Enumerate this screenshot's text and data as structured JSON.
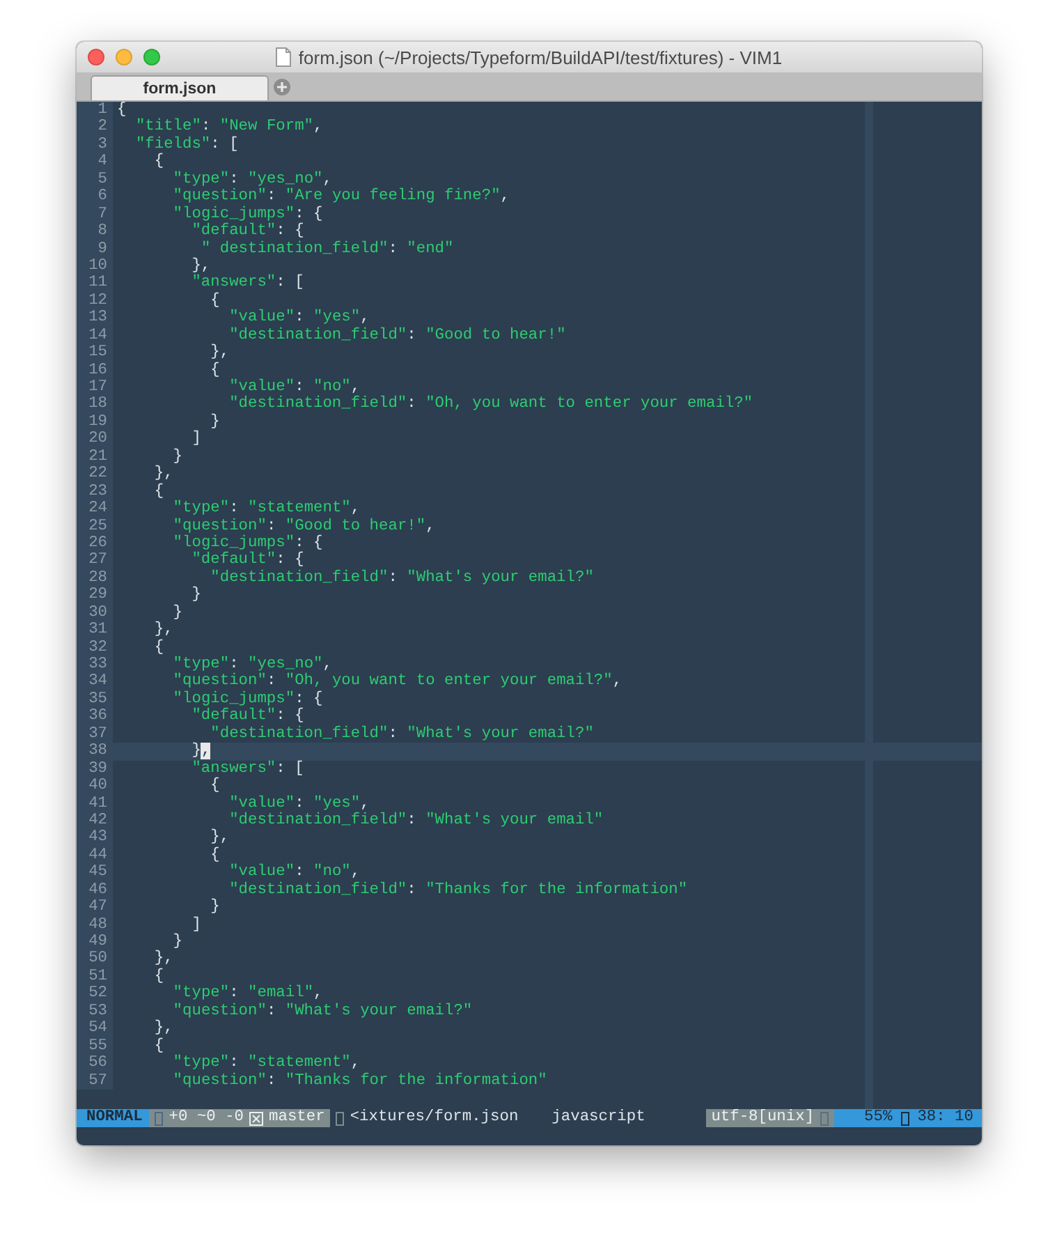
{
  "window": {
    "title": "form.json (~/Projects/Typeform/BuildAPI/test/fixtures) - VIM1"
  },
  "tabs": [
    {
      "label": "form.json",
      "selected": true
    }
  ],
  "lines": [
    {
      "n": "1",
      "text": "{",
      "current": false
    },
    {
      "n": "2",
      "text": "  \"title\": \"New Form\",",
      "current": false
    },
    {
      "n": "3",
      "text": "  \"fields\": [",
      "current": false
    },
    {
      "n": "4",
      "text": "    {",
      "current": false
    },
    {
      "n": "5",
      "text": "      \"type\": \"yes_no\",",
      "current": false
    },
    {
      "n": "6",
      "text": "      \"question\": \"Are you feeling fine?\",",
      "current": false
    },
    {
      "n": "7",
      "text": "      \"logic_jumps\": {",
      "current": false
    },
    {
      "n": "8",
      "text": "        \"default\": {",
      "current": false
    },
    {
      "n": "9",
      "text": "         \" destination_field\": \"end\"",
      "current": false
    },
    {
      "n": "10",
      "text": "        },",
      "current": false
    },
    {
      "n": "11",
      "text": "        \"answers\": [",
      "current": false
    },
    {
      "n": "12",
      "text": "          {",
      "current": false
    },
    {
      "n": "13",
      "text": "            \"value\": \"yes\",",
      "current": false
    },
    {
      "n": "14",
      "text": "            \"destination_field\": \"Good to hear!\"",
      "current": false
    },
    {
      "n": "15",
      "text": "          },",
      "current": false
    },
    {
      "n": "16",
      "text": "          {",
      "current": false
    },
    {
      "n": "17",
      "text": "            \"value\": \"no\",",
      "current": false
    },
    {
      "n": "18",
      "text": "            \"destination_field\": \"Oh, you want to enter your email?\"",
      "current": false
    },
    {
      "n": "19",
      "text": "          }",
      "current": false
    },
    {
      "n": "20",
      "text": "        ]",
      "current": false
    },
    {
      "n": "21",
      "text": "      }",
      "current": false
    },
    {
      "n": "22",
      "text": "    },",
      "current": false
    },
    {
      "n": "23",
      "text": "    {",
      "current": false
    },
    {
      "n": "24",
      "text": "      \"type\": \"statement\",",
      "current": false
    },
    {
      "n": "25",
      "text": "      \"question\": \"Good to hear!\",",
      "current": false
    },
    {
      "n": "26",
      "text": "      \"logic_jumps\": {",
      "current": false
    },
    {
      "n": "27",
      "text": "        \"default\": {",
      "current": false
    },
    {
      "n": "28",
      "text": "          \"destination_field\": \"What's your email?\"",
      "current": false
    },
    {
      "n": "29",
      "text": "        }",
      "current": false
    },
    {
      "n": "30",
      "text": "      }",
      "current": false
    },
    {
      "n": "31",
      "text": "    },",
      "current": false
    },
    {
      "n": "32",
      "text": "    {",
      "current": false
    },
    {
      "n": "33",
      "text": "      \"type\": \"yes_no\",",
      "current": false
    },
    {
      "n": "34",
      "text": "      \"question\": \"Oh, you want to enter your email?\",",
      "current": false
    },
    {
      "n": "35",
      "text": "      \"logic_jumps\": {",
      "current": false
    },
    {
      "n": "36",
      "text": "        \"default\": {",
      "current": false
    },
    {
      "n": "37",
      "text": "          \"destination_field\": \"What's your email?\"",
      "current": false
    },
    {
      "n": "38",
      "text": "        }",
      "cursor": ",",
      "current": true
    },
    {
      "n": "39",
      "text": "        \"answers\": [",
      "current": false
    },
    {
      "n": "40",
      "text": "          {",
      "current": false
    },
    {
      "n": "41",
      "text": "            \"value\": \"yes\",",
      "current": false
    },
    {
      "n": "42",
      "text": "            \"destination_field\": \"What's your email\"",
      "current": false
    },
    {
      "n": "43",
      "text": "          },",
      "current": false
    },
    {
      "n": "44",
      "text": "          {",
      "current": false
    },
    {
      "n": "45",
      "text": "            \"value\": \"no\",",
      "current": false
    },
    {
      "n": "46",
      "text": "            \"destination_field\": \"Thanks for the information\"",
      "current": false
    },
    {
      "n": "47",
      "text": "          }",
      "current": false
    },
    {
      "n": "48",
      "text": "        ]",
      "current": false
    },
    {
      "n": "49",
      "text": "      }",
      "current": false
    },
    {
      "n": "50",
      "text": "    },",
      "current": false
    },
    {
      "n": "51",
      "text": "    {",
      "current": false
    },
    {
      "n": "52",
      "text": "      \"type\": \"email\",",
      "current": false
    },
    {
      "n": "53",
      "text": "      \"question\": \"What's your email?\"",
      "current": false
    },
    {
      "n": "54",
      "text": "    },",
      "current": false
    },
    {
      "n": "55",
      "text": "    {",
      "current": false
    },
    {
      "n": "56",
      "text": "      \"type\": \"statement\",",
      "current": false
    },
    {
      "n": "57",
      "text": "      \"question\": \"Thanks for the information\"",
      "current": false
    }
  ],
  "status_bar": {
    "mode": "NORMAL",
    "hunks": "+0 ~0 -0",
    "branch": "master",
    "file": "<ixtures/form.json",
    "filetype": "javascript",
    "encoding": "utf-8[unix]",
    "percent": "55%",
    "position": "38: 10"
  }
}
